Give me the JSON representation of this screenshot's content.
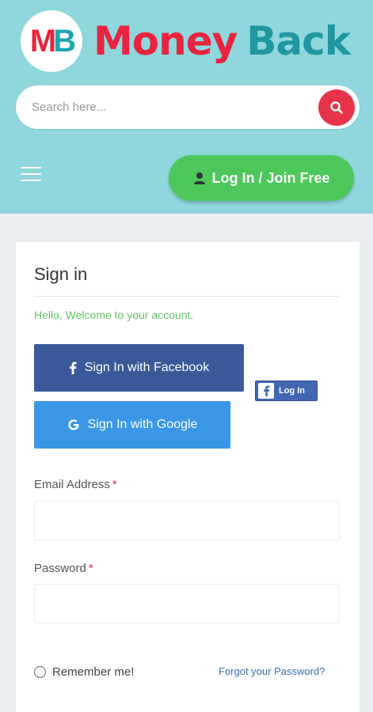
{
  "brand": {
    "logo_mark_m": "M",
    "logo_mark_b": "B",
    "word1": "Money",
    "word2": "Back"
  },
  "search": {
    "placeholder": "Search here...",
    "icon": "search-icon"
  },
  "nav": {
    "menu_icon": "hamburger-icon",
    "login_label": "Log In / Join Free"
  },
  "signin": {
    "title": "Sign in",
    "welcome": "Hello, Welcome to your account.",
    "facebook_label": "Sign In with Facebook",
    "google_label": "Sign In with Google",
    "fb_small_label": "Log In",
    "email_label": "Email Address",
    "password_label": "Password",
    "required_mark": "*",
    "email_value": "",
    "password_value": "",
    "remember_label": "Remember me!",
    "forgot_label": "Forgot your Password?"
  },
  "colors": {
    "header_bg": "#8fd6dd",
    "brand_red": "#e8243f",
    "brand_teal": "#1f97a0",
    "login_green": "#4cc85a",
    "facebook_blue": "#3b5998",
    "google_blue": "#3a97e6",
    "welcome_green": "#61c463"
  }
}
